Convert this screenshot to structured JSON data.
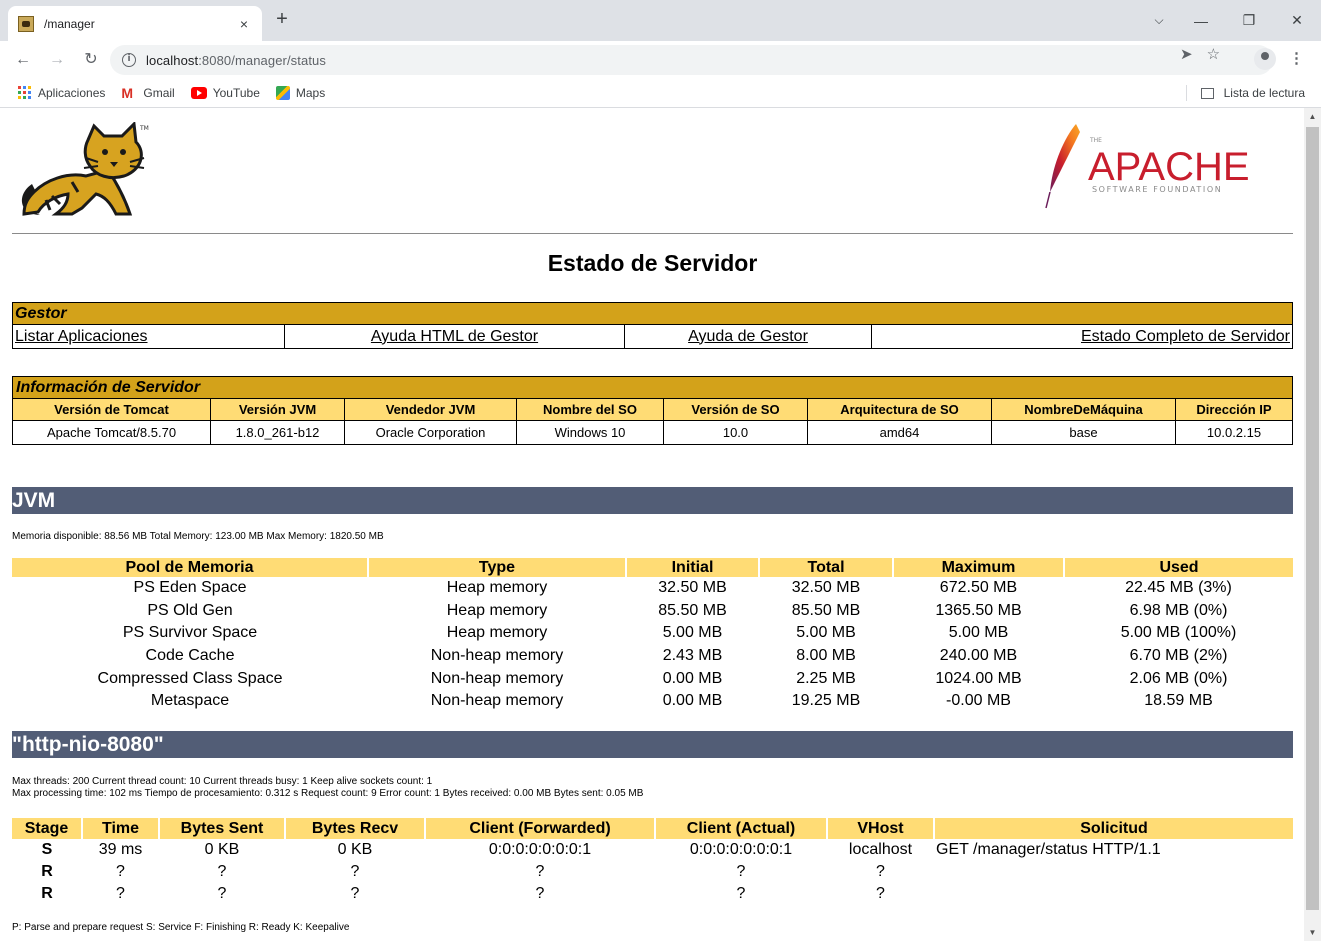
{
  "browser": {
    "tab_title": "/manager",
    "tab_close": "×",
    "new_tab": "+",
    "url_host": "localhost",
    "url_path": ":8080/manager/status",
    "bookmarks": [
      {
        "label": "Aplicaciones"
      },
      {
        "label": "Gmail"
      },
      {
        "label": "YouTube"
      },
      {
        "label": "Maps"
      }
    ],
    "reading_list": "Lista de lectura"
  },
  "page": {
    "title": "Estado de Servidor",
    "apache_top": "THE",
    "apache_name": "APACHE",
    "apache_sub": "SOFTWARE FOUNDATION",
    "tomcat_tm": "TM",
    "gestor": {
      "header": "Gestor",
      "links": [
        "Listar Aplicaciones",
        "Ayuda HTML de Gestor",
        "Ayuda de Gestor",
        "Estado Completo de Servidor"
      ]
    },
    "server_info": {
      "header": "Información de Servidor",
      "columns": [
        "Versión de Tomcat",
        "Versión JVM",
        "Vendedor JVM",
        "Nombre del SO",
        "Versión de SO",
        "Arquitectura de SO",
        "NombreDeMáquina",
        "Dirección IP"
      ],
      "values": [
        "Apache Tomcat/8.5.70",
        "1.8.0_261-b12",
        "Oracle Corporation",
        "Windows 10",
        "10.0",
        "amd64",
        "base",
        "10.0.2.15"
      ]
    },
    "jvm": {
      "header": "JVM",
      "summary": "Memoria disponible: 88.56 MB Total Memory: 123.00 MB Max Memory: 1820.50 MB",
      "columns": [
        "Pool de Memoria",
        "Type",
        "Initial",
        "Total",
        "Maximum",
        "Used"
      ],
      "rows": [
        [
          "PS Eden Space",
          "Heap memory",
          "32.50 MB",
          "32.50 MB",
          "672.50 MB",
          "22.45 MB (3%)"
        ],
        [
          "PS Old Gen",
          "Heap memory",
          "85.50 MB",
          "85.50 MB",
          "1365.50 MB",
          "6.98 MB (0%)"
        ],
        [
          "PS Survivor Space",
          "Heap memory",
          "5.00 MB",
          "5.00 MB",
          "5.00 MB",
          "5.00 MB (100%)"
        ],
        [
          "Code Cache",
          "Non-heap memory",
          "2.43 MB",
          "8.00 MB",
          "240.00 MB",
          "6.70 MB (2%)"
        ],
        [
          "Compressed Class Space",
          "Non-heap memory",
          "0.00 MB",
          "2.25 MB",
          "1024.00 MB",
          "2.06 MB (0%)"
        ],
        [
          "Metaspace",
          "Non-heap memory",
          "0.00 MB",
          "19.25 MB",
          "-0.00 MB",
          "18.59 MB"
        ]
      ]
    },
    "connector": {
      "header": "\"http-nio-8080\"",
      "summary_line1": "Max threads: 200 Current thread count: 10 Current threads busy: 1 Keep alive sockets count: 1",
      "summary_line2": "Max processing time: 102 ms Tiempo de procesamiento: 0.312 s Request count: 9 Error count: 1 Bytes received: 0.00 MB Bytes sent: 0.05 MB",
      "columns": [
        "Stage",
        "Time",
        "Bytes Sent",
        "Bytes Recv",
        "Client (Forwarded)",
        "Client (Actual)",
        "VHost",
        "Solicitud"
      ],
      "rows": [
        [
          "S",
          "39 ms",
          "0 KB",
          "0 KB",
          "0:0:0:0:0:0:0:1",
          "0:0:0:0:0:0:0:1",
          "localhost",
          "GET /manager/status HTTP/1.1"
        ],
        [
          "R",
          "?",
          "?",
          "?",
          "?",
          "?",
          "?",
          ""
        ],
        [
          "R",
          "?",
          "?",
          "?",
          "?",
          "?",
          "?",
          ""
        ]
      ],
      "legend": "P: Parse and prepare request S: Service F: Finishing R: Ready K: Keepalive"
    }
  },
  "colors": {
    "gold_header": "#d3a21a",
    "light_header": "#ffdc75",
    "section_bar": "#525d76"
  }
}
